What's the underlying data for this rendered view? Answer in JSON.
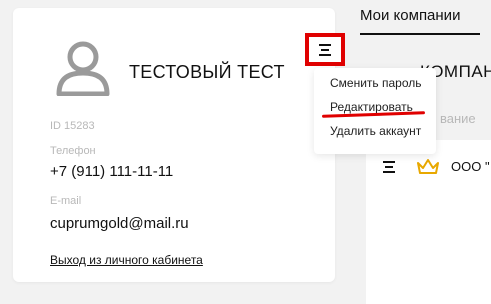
{
  "profile": {
    "name": "ТЕСТОВЫЙ ТЕСТ",
    "id_label": "ID 15283",
    "phone_label": "Телефон",
    "phone": "+7 (911) 111-11-11",
    "email_label": "E-mail",
    "email": "cuprumgold@mail.ru",
    "logout": "Выход из личного кабинета"
  },
  "menu": {
    "items": [
      {
        "label": "Сменить пароль"
      },
      {
        "label": "Редактировать"
      },
      {
        "label": "Удалить аккаунт"
      }
    ]
  },
  "companies": {
    "tab_title": "Мои компании",
    "section_head": "КОМПАН",
    "search_placeholder": "вание",
    "items": [
      {
        "name": "ООО \""
      }
    ]
  },
  "colors": {
    "highlight": "#e00000",
    "crown": "#e8a800",
    "muted": "#b8b8b8"
  }
}
